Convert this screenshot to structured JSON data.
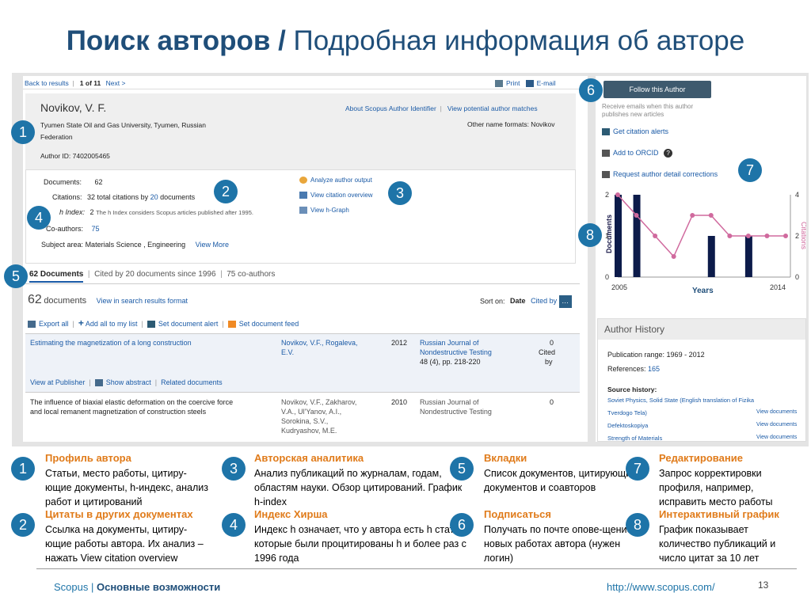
{
  "slide": {
    "title_bold": "Поиск авторов /",
    "title_rest": " Подробная информация об авторе",
    "footer_left": "Scopus |",
    "footer_left_bold": " Основные возможности",
    "footer_url": "http://www.scopus.com/",
    "page_number": "13"
  },
  "topbar": {
    "back": "Back to results",
    "count": "1 of 11",
    "next": "Next >",
    "print": "Print",
    "email": "E-mail"
  },
  "profile": {
    "name": "Novikov, V. F.",
    "affiliation_1": "Tyumen State Oil and Gas University, Tyumen, Russian",
    "affiliation_2": "Federation",
    "author_id": "Author ID: 7402005465",
    "about_link": "About Scopus Author Identifier",
    "matches_link": "View potential author matches",
    "other_names": "Other name formats: Novikov"
  },
  "metrics": {
    "documents_label": "Documents:",
    "documents_value": "62",
    "citations_label": "Citations:",
    "citations_pre": "32 total citations by",
    "citations_link": "20",
    "citations_post": "documents",
    "hindex_label": "h Index:",
    "hindex_value": "2",
    "hindex_note": "The h Index considers Scopus articles published after 1995.",
    "coauthors_label": "Co-authors:",
    "coauthors_value": "75",
    "subject_label": "Subject area:",
    "subject_value": "Materials Science ,  Engineering",
    "view_more": "View More",
    "analyze_link": "Analyze author output",
    "citation_overview_link": "View citation overview",
    "hgraph_link": "View h-Graph"
  },
  "tabs": {
    "documents": "62 Documents",
    "cited_by": "Cited by 20 documents since 1996",
    "coauthors": "75 co-authors"
  },
  "docs": {
    "count_num": "62",
    "count_word": "documents",
    "view_link": "View in search results format",
    "sort_label": "Sort on:",
    "sort_date": "Date",
    "sort_cited": "Cited by",
    "export": "Export all",
    "add_list": "Add all to my list",
    "set_alert": "Set document alert",
    "set_feed": "Set document feed",
    "rows": [
      {
        "title": "Estimating the magnetization of a long construction",
        "authors_1": "Novikov, V.F., Rogaleva,",
        "authors_2": "E.V.",
        "year": "2012",
        "source_1": "Russian Journal of",
        "source_2": "Nondestructive Testing",
        "source_3": "48 (4), pp. 218-220",
        "cited_1": "0",
        "cited_2": "Cited",
        "cited_3": "by"
      },
      {
        "title_1": "The influence of biaxial elastic deformation on the coercive force",
        "title_2": "and local remanent magnetization of construction steels",
        "authors_1": "Novikov, V.F., Zakharov,",
        "authors_2": "V.A., Ul'Yanov, A.I.,",
        "authors_3": "Sorokina, S.V.,",
        "authors_4": "Kudryashov, M.E.",
        "year": "2010",
        "source_1": "Russian Journal of",
        "source_2": "Nondestructive Testing",
        "cited_1": "0"
      }
    ],
    "row_actions": {
      "publisher": "View at Publisher",
      "abstract": "Show abstract",
      "related": "Related documents"
    }
  },
  "sidebar": {
    "follow": "Follow this Author",
    "follow_note_1": "Receive emails when this author",
    "follow_note_2": "publishes new articles",
    "citation_alerts": "Get citation alerts",
    "orcid": "Add to ORCID",
    "corrections": "Request author detail corrections",
    "history_title": "Author History",
    "pub_range": "Publication range: 1969 - 2012",
    "references_label": "References:",
    "references_value": "165",
    "source_history": "Source history:",
    "sources": [
      {
        "name": "Soviet Physics, Solid State (English translation of Fizika",
        "link": ""
      },
      {
        "name": "Tverdogo Tela)",
        "link": "View documents"
      },
      {
        "name": "Defektoskopiya",
        "link": "View documents"
      },
      {
        "name": "Strength of Materials",
        "link": "View documents"
      }
    ]
  },
  "chart_data": {
    "type": "bar",
    "x": [
      2005,
      2006,
      2007,
      2008,
      2009,
      2010,
      2011,
      2012,
      2013,
      2014
    ],
    "series": [
      {
        "name": "Documents",
        "values": [
          2,
          2,
          0,
          0,
          0,
          1,
          0,
          1,
          0,
          0
        ]
      },
      {
        "name": "Citations",
        "values": [
          4,
          3,
          2,
          1,
          3,
          3,
          2,
          2,
          2,
          2
        ]
      }
    ],
    "xticks": [
      "2005",
      "2014"
    ],
    "xlabel": "Years",
    "ylabel_left": "Documents",
    "ylabel_right": "Citations",
    "yleft_ticks": [
      "2",
      "1",
      "0"
    ],
    "yright_ticks": [
      "4",
      "2",
      "0"
    ],
    "ylim_left": [
      0,
      2
    ],
    "ylim_right": [
      0,
      4
    ],
    "colors": {
      "bars": "#0c1b4a",
      "line": "#d06a9e"
    }
  },
  "legend": [
    {
      "n": "1",
      "title": "Профиль автора",
      "desc": "Статьи, место работы, цитиру-ющие документы, h-индекс, анализ работ и цитирований"
    },
    {
      "n": "2",
      "title": "Цитаты в других документах",
      "desc": "Ссылка на документы, цитиру-ющие работы автора. Их анализ – нажать View citation overview"
    },
    {
      "n": "3",
      "title": "Авторская аналитика",
      "desc": "Анализ публикаций по журналам, годам, областям науки. Обзор цитирований. График h-index"
    },
    {
      "n": "4",
      "title": "Индекс Хирша",
      "desc": "Индекс h означает, что у автора есть h статей, которые были процитированы h  и более раз с 1996 года"
    },
    {
      "n": "5",
      "title": "Вкладки",
      "desc": "Список документов, цитирующих документов и соавторов"
    },
    {
      "n": "6",
      "title": "Подписаться",
      "desc": "Получать по почте опове-щение о новых работах автора (нужен логин)"
    },
    {
      "n": "7",
      "title": "Редактирование",
      "desc": "Запрос корректировки профиля, например, исправить место работы"
    },
    {
      "n": "8",
      "title": "Интерактивный график",
      "desc": "График показывает количество публикаций и число цитат за 10 лет"
    }
  ],
  "colors": {
    "accent": "#1e74a8",
    "title": "#1f4e79",
    "legend_title": "#e07b1a",
    "link": "#1a5aa6"
  }
}
